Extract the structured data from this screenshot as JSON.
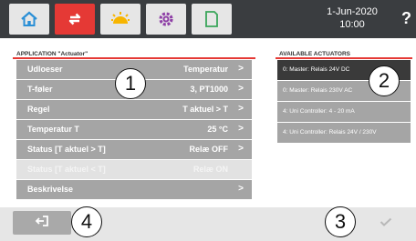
{
  "header": {
    "date": "1-Jun-2020",
    "time": "10:00",
    "help_label": "?",
    "tabs": [
      {
        "icon": "home-icon"
      },
      {
        "icon": "transfer-icon",
        "active": true
      },
      {
        "icon": "sun-icon"
      },
      {
        "icon": "gear-icon"
      },
      {
        "icon": "document-icon"
      }
    ]
  },
  "application": {
    "title": "APPLICATION \"Actuator\"",
    "rows": [
      {
        "label": "Udloeser",
        "value": "Temperatur",
        "chevron": ">"
      },
      {
        "label": "T-føler",
        "value": "3, PT1000",
        "chevron": ">"
      },
      {
        "label": "Regel",
        "value": "T aktuel > T",
        "chevron": ">"
      },
      {
        "label": "Temperatur T",
        "value": "25 °C",
        "chevron": ">"
      },
      {
        "label": "Status [T aktuel > T]",
        "value": "Relæ OFF",
        "chevron": ">"
      },
      {
        "label": "Status [T aktuel < T]",
        "value": "Relæ ON",
        "chevron": ""
      },
      {
        "label": "Beskrivelse",
        "value": "",
        "chevron": ">"
      }
    ]
  },
  "actuators": {
    "title": "AVAILABLE ACTUATORS",
    "items": [
      "0: Master: Relais 24V DC",
      "0: Master: Relais 230V AC",
      "4: Uni Controller: 4 - 20 mA",
      "4: Uni Controller: Relais 24V / 230V"
    ],
    "selected_index": 0
  },
  "callouts": [
    "1",
    "2",
    "3",
    "4"
  ],
  "colors": {
    "accent": "#e53935",
    "topbar": "#3a3d40",
    "row": "#a5a5a5",
    "row_disabled": "#e2e2e2",
    "selected": "#3a3a3a"
  }
}
